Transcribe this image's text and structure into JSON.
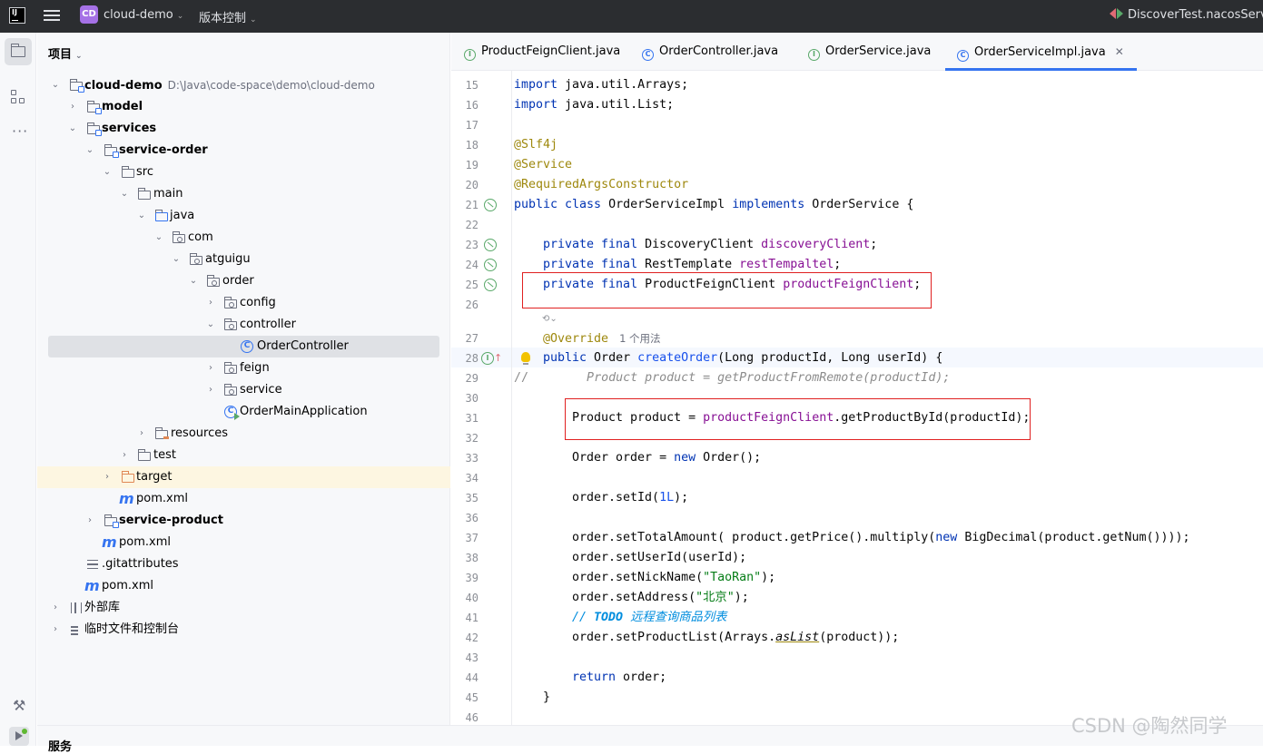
{
  "titlebar": {
    "logo_text": "IJ",
    "project_badge": "CD",
    "project_name": "cloud-demo",
    "vcs_label": "版本控制",
    "run_config": "DiscoverTest.nacosServic"
  },
  "project_panel": {
    "title": "项目",
    "tree": [
      {
        "label": "cloud-demo",
        "path": "D:\\Java\\code-space\\demo\\cloud-demo"
      },
      {
        "label": "model"
      },
      {
        "label": "services"
      },
      {
        "label": "service-order"
      },
      {
        "label": "src"
      },
      {
        "label": "main"
      },
      {
        "label": "java"
      },
      {
        "label": "com"
      },
      {
        "label": "atguigu"
      },
      {
        "label": "order"
      },
      {
        "label": "config"
      },
      {
        "label": "controller"
      },
      {
        "label": "OrderController"
      },
      {
        "label": "feign"
      },
      {
        "label": "service"
      },
      {
        "label": "OrderMainApplication"
      },
      {
        "label": "resources"
      },
      {
        "label": "test"
      },
      {
        "label": "target"
      },
      {
        "label": "pom.xml"
      },
      {
        "label": "service-product"
      },
      {
        "label": "pom.xml"
      },
      {
        "label": ".gitattributes"
      },
      {
        "label": "pom.xml"
      },
      {
        "label": "外部库"
      },
      {
        "label": "临时文件和控制台"
      }
    ]
  },
  "tabs": [
    {
      "label": "ProductFeignClient.java",
      "icon": "interface-icon"
    },
    {
      "label": "OrderController.java",
      "icon": "class-icon"
    },
    {
      "label": "OrderService.java",
      "icon": "interface-icon"
    },
    {
      "label": "OrderServiceImpl.java",
      "icon": "class-icon",
      "active": true
    }
  ],
  "editor": {
    "line_numbers": [
      "15",
      "16",
      "17",
      "18",
      "19",
      "20",
      "21",
      "22",
      "23",
      "24",
      "25",
      "26",
      "27",
      "28",
      "29",
      "30",
      "31",
      "32",
      "33",
      "34",
      "35",
      "36",
      "37",
      "38",
      "39",
      "40",
      "41",
      "42",
      "43",
      "44",
      "45",
      "46"
    ],
    "usage_hint": "1 个用法",
    "code": {
      "l15a": "import",
      "l15b": " java.util.Arrays;",
      "l16a": "import",
      "l16b": " java.util.List;",
      "l18": "@Slf4j",
      "l19": "@Service",
      "l20": "@RequiredArgsConstructor",
      "l21a": "public class",
      "l21b": " OrderServiceImpl ",
      "l21c": "implements",
      "l21d": " OrderService {",
      "l23a": "private final",
      "l23b": " DiscoveryClient ",
      "l23c": "discoveryClient",
      "l23d": ";",
      "l24a": "private final",
      "l24b": " RestTemplate ",
      "l24c": "restTempaltel",
      "l24d": ";",
      "l25a": "private final",
      "l25b": " ProductFeignClient ",
      "l25c": "productFeignClient",
      "l25d": ";",
      "l27": "@Override",
      "l28a": "public",
      "l28b": " Order ",
      "l28c": "createOrder",
      "l28d": "(Long productId, Long userId) {",
      "l29a": "//",
      "l29b": "        Product product = getProductFromRemote(productId);",
      "l31a": "Product product = ",
      "l31b": "productFeignClient",
      "l31c": ".getProductById(productId);",
      "l33a": "Order order = ",
      "l33b": "new",
      "l33c": " Order();",
      "l35a": "order.setId(",
      "l35b": "1L",
      "l35c": ");",
      "l37a": "order.setTotalAmount( product.getPrice().multiply(",
      "l37b": "new",
      "l37c": " BigDecimal(product.getNum())));",
      "l38": "order.setUserId(userId);",
      "l39a": "order.setNickName(",
      "l39b": "\"TaoRan\"",
      "l39c": ");",
      "l40a": "order.setAddress(",
      "l40b": "\"北京\"",
      "l40c": ");",
      "l41a": "// ",
      "l41b": "TODO",
      "l41c": " 远程查询商品列表",
      "l42a": "order.setProductList(Arrays.",
      "l42b": "asList",
      "l42c": "(product));",
      "l44a": "return",
      "l44b": " order;",
      "l45": "}"
    }
  },
  "bottom": {
    "services_label": "服务"
  },
  "watermark": "CSDN @陶然同学",
  "colors": {
    "keyword": "#0033b3",
    "annotation": "#9e880d",
    "field": "#871094",
    "string": "#067d17",
    "highlight_box": "#e02020",
    "accent": "#3574f0"
  }
}
